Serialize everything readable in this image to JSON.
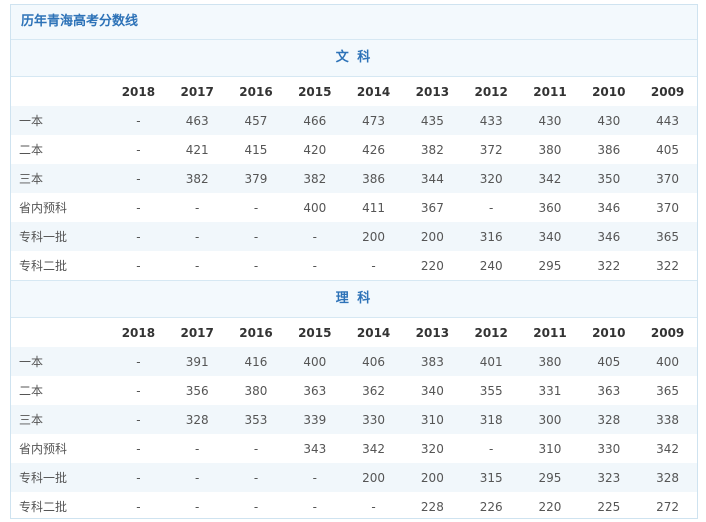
{
  "panel_title": "历年青海高考分数线",
  "years": [
    "2018",
    "2017",
    "2016",
    "2015",
    "2014",
    "2013",
    "2012",
    "2011",
    "2010",
    "2009"
  ],
  "sections": [
    {
      "title": "文 科",
      "rows": [
        {
          "label": "一本",
          "values": [
            "-",
            "463",
            "457",
            "466",
            "473",
            "435",
            "433",
            "430",
            "430",
            "443"
          ]
        },
        {
          "label": "二本",
          "values": [
            "-",
            "421",
            "415",
            "420",
            "426",
            "382",
            "372",
            "380",
            "386",
            "405"
          ]
        },
        {
          "label": "三本",
          "values": [
            "-",
            "382",
            "379",
            "382",
            "386",
            "344",
            "320",
            "342",
            "350",
            "370"
          ]
        },
        {
          "label": "省内预科",
          "values": [
            "-",
            "-",
            "-",
            "400",
            "411",
            "367",
            "-",
            "360",
            "346",
            "370"
          ]
        },
        {
          "label": "专科一批",
          "values": [
            "-",
            "-",
            "-",
            "-",
            "200",
            "200",
            "316",
            "340",
            "346",
            "365"
          ]
        },
        {
          "label": "专科二批",
          "values": [
            "-",
            "-",
            "-",
            "-",
            "-",
            "220",
            "240",
            "295",
            "322",
            "322"
          ]
        }
      ]
    },
    {
      "title": "理 科",
      "rows": [
        {
          "label": "一本",
          "values": [
            "-",
            "391",
            "416",
            "400",
            "406",
            "383",
            "401",
            "380",
            "405",
            "400"
          ]
        },
        {
          "label": "二本",
          "values": [
            "-",
            "356",
            "380",
            "363",
            "362",
            "340",
            "355",
            "331",
            "363",
            "365"
          ]
        },
        {
          "label": "三本",
          "values": [
            "-",
            "328",
            "353",
            "339",
            "330",
            "310",
            "318",
            "300",
            "328",
            "338"
          ]
        },
        {
          "label": "省内预科",
          "values": [
            "-",
            "-",
            "-",
            "343",
            "342",
            "320",
            "-",
            "310",
            "330",
            "342"
          ]
        },
        {
          "label": "专科一批",
          "values": [
            "-",
            "-",
            "-",
            "-",
            "200",
            "200",
            "315",
            "295",
            "323",
            "328"
          ]
        },
        {
          "label": "专科二批",
          "values": [
            "-",
            "-",
            "-",
            "-",
            "-",
            "228",
            "226",
            "220",
            "225",
            "272"
          ]
        }
      ]
    }
  ],
  "colors": {
    "title_blue": "#2e73b8",
    "header_bg": "#f3f9fd",
    "alt_row_bg": "#f1f7fb",
    "border": "#cfe3f0"
  }
}
